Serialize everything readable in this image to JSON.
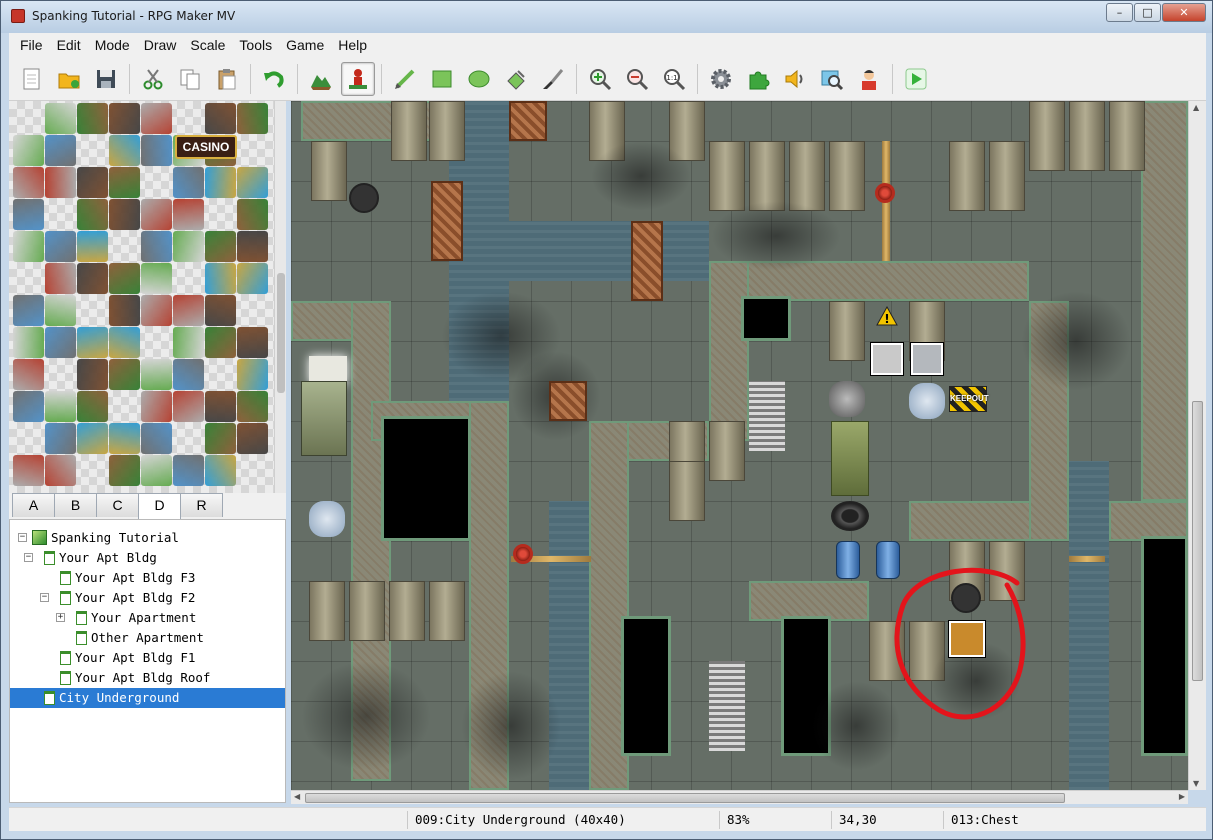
{
  "window": {
    "title": "Spanking Tutorial - RPG Maker MV",
    "controls": {
      "minimize": "–",
      "maximize": "□",
      "close": "✕"
    }
  },
  "menu": [
    "File",
    "Edit",
    "Mode",
    "Draw",
    "Scale",
    "Tools",
    "Game",
    "Help"
  ],
  "toolbar": {
    "buttons": [
      {
        "name": "new-project-icon"
      },
      {
        "name": "open-project-icon"
      },
      {
        "name": "save-project-icon"
      },
      {
        "name": "cut-icon"
      },
      {
        "name": "copy-icon"
      },
      {
        "name": "paste-icon"
      },
      {
        "name": "undo-icon"
      },
      {
        "name": "map-mode-icon"
      },
      {
        "name": "event-mode-icon",
        "active": true
      },
      {
        "name": "pencil-icon"
      },
      {
        "name": "rectangle-icon"
      },
      {
        "name": "ellipse-icon"
      },
      {
        "name": "flood-fill-icon"
      },
      {
        "name": "shadow-pen-icon"
      },
      {
        "name": "zoom-in-icon"
      },
      {
        "name": "zoom-out-icon"
      },
      {
        "name": "zoom-actual-icon"
      },
      {
        "name": "database-icon"
      },
      {
        "name": "plugin-manager-icon"
      },
      {
        "name": "sound-test-icon"
      },
      {
        "name": "resource-manager-icon"
      },
      {
        "name": "character-generator-icon"
      },
      {
        "name": "playtest-icon"
      }
    ],
    "zoom_actual_label": "1:1"
  },
  "tileset_tabs": [
    "A",
    "B",
    "C",
    "D",
    "R"
  ],
  "active_tileset_tab": "D",
  "map_tree": [
    {
      "label": "Spanking Tutorial",
      "level": 0,
      "expander": "−",
      "type": "project"
    },
    {
      "label": "Your Apt Bldg",
      "level": 1,
      "expander": "−",
      "type": "map"
    },
    {
      "label": "Your Apt Bldg F3",
      "level": 2,
      "expander": "",
      "type": "map"
    },
    {
      "label": "Your Apt Bldg F2",
      "level": 2,
      "expander": "−",
      "type": "map"
    },
    {
      "label": "Your Apartment",
      "level": 3,
      "expander": "+",
      "type": "map"
    },
    {
      "label": "Other Apartment",
      "level": 3,
      "expander": "",
      "type": "map"
    },
    {
      "label": "Your Apt Bldg F1",
      "level": 2,
      "expander": "",
      "type": "map"
    },
    {
      "label": "Your Apt Bldg Roof",
      "level": 2,
      "expander": "",
      "type": "map"
    },
    {
      "label": "City Underground",
      "level": 1,
      "expander": "",
      "type": "map",
      "selected": true
    }
  ],
  "map_signs": {
    "casino": "CASINO",
    "keep_out": "KEEPOUT"
  },
  "status": {
    "map": "009:City Underground (40x40)",
    "zoom": "83%",
    "coords": "34,30",
    "event": "013:Chest"
  },
  "colors": {
    "selection": "#2a7bd4",
    "annotation": "#e3141b",
    "playtest": "#35b23a"
  }
}
